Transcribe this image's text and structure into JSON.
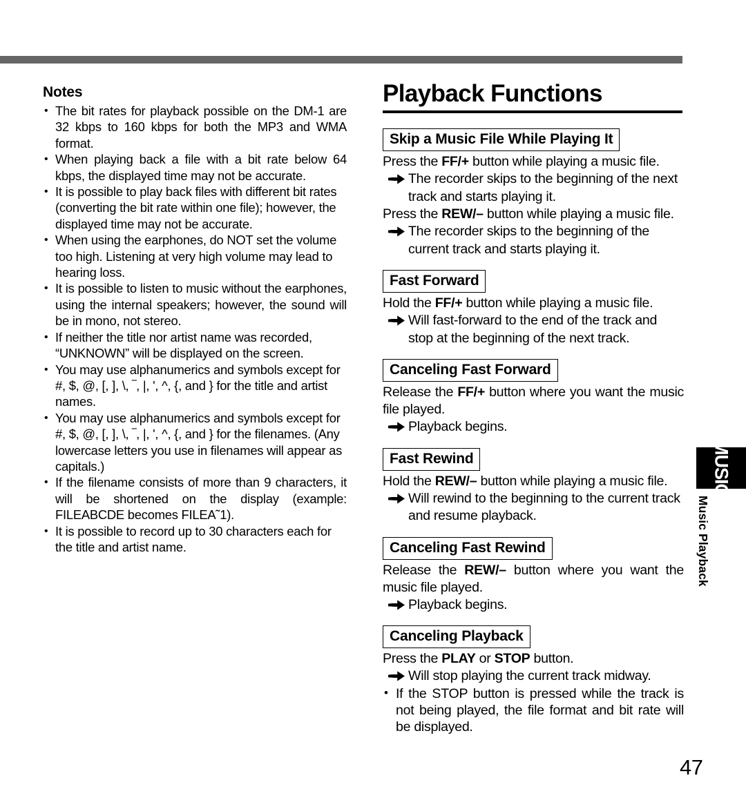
{
  "page": {
    "number": "47",
    "side_tab_label": "MUSIC",
    "side_caption": "Music Playback"
  },
  "left_column": {
    "heading": "Notes",
    "notes": [
      "The bit rates for playback possible on the DM-1 are 32 kbps to 160 kbps for both the MP3 and WMA format.",
      "When playing back a file with a bit rate below 64 kbps, the displayed time may not be accurate.",
      "It is possible to play back files with different bit rates (converting the bit rate within one file); however, the displayed time may not be accurate.",
      "When using the earphones, do NOT set the volume too high. Listening at very high volume may lead to hearing loss.",
      "It is possible to listen to music without the earphones, using the internal speakers; however, the sound will be in mono, not stereo.",
      "If neither the title nor artist name was recorded, “UNKNOWN” will be displayed on the screen.",
      "You may use alphanumerics and symbols except for #, $, @, [, ], \\, ‾, |, ', ^,  {, and } for the title and artist names.",
      "You may use alphanumerics and symbols except for #, $, @, [, ], \\, ‾, |, ', ^,  {, and } for the filenames. (Any lowercase letters you use in filenames will appear as capitals.)",
      "If the filename consists of more than 9 characters, it will be shortened on the display (example: FILEABCDE  becomes FILEA˜1).",
      "It is possible to record up to 30 characters each for the title and artist name."
    ]
  },
  "right_column": {
    "title": "Playback Functions",
    "sections": [
      {
        "heading": "Skip a Music File While Playing It",
        "lines": [
          {
            "type": "instruction",
            "pre": "Press the ",
            "bold": "FF/+",
            "post": " button while playing a music file."
          },
          {
            "type": "arrow",
            "text": "The recorder skips to the beginning of the next track and starts playing it."
          },
          {
            "type": "instruction",
            "pre": "Press the ",
            "bold": "REW/–",
            "post": " button while playing a music file."
          },
          {
            "type": "arrow",
            "text": "The recorder skips to the beginning of the current track and starts playing it."
          }
        ]
      },
      {
        "heading": "Fast Forward",
        "lines": [
          {
            "type": "instruction",
            "pre": "Hold the ",
            "bold": "FF/+",
            "post": " button while playing a music file."
          },
          {
            "type": "arrow",
            "text": "Will fast-forward to the end of the track and stop at the beginning of the next track."
          }
        ]
      },
      {
        "heading": "Canceling Fast Forward",
        "lines": [
          {
            "type": "instruction-justify",
            "pre": "Release the ",
            "bold": "FF/+",
            "post": " button where you want the music file played."
          },
          {
            "type": "arrow",
            "text": "Playback begins."
          }
        ]
      },
      {
        "heading": "Fast Rewind",
        "lines": [
          {
            "type": "instruction",
            "pre": "Hold the ",
            "bold": "REW/–",
            "post": " button while playing a music file."
          },
          {
            "type": "arrow",
            "text": "Will rewind to the beginning to the current track and resume playback."
          }
        ]
      },
      {
        "heading": "Canceling Fast Rewind",
        "lines": [
          {
            "type": "instruction-justify",
            "pre": "Release the ",
            "bold": "REW/–",
            "post": " button where you want the music file played."
          },
          {
            "type": "arrow",
            "text": "Playback begins."
          }
        ]
      },
      {
        "heading": "Canceling Playback",
        "lines": [
          {
            "type": "instruction-two-bold",
            "pre": "Press the ",
            "bold": "PLAY",
            "mid": " or ",
            "bold2": "STOP",
            "post": " button."
          },
          {
            "type": "arrow",
            "text": "Will stop playing the current track midway."
          },
          {
            "type": "bullet",
            "text": "If the STOP button is pressed while the track is not being played, the file format and bit rate will be displayed."
          }
        ]
      }
    ]
  }
}
